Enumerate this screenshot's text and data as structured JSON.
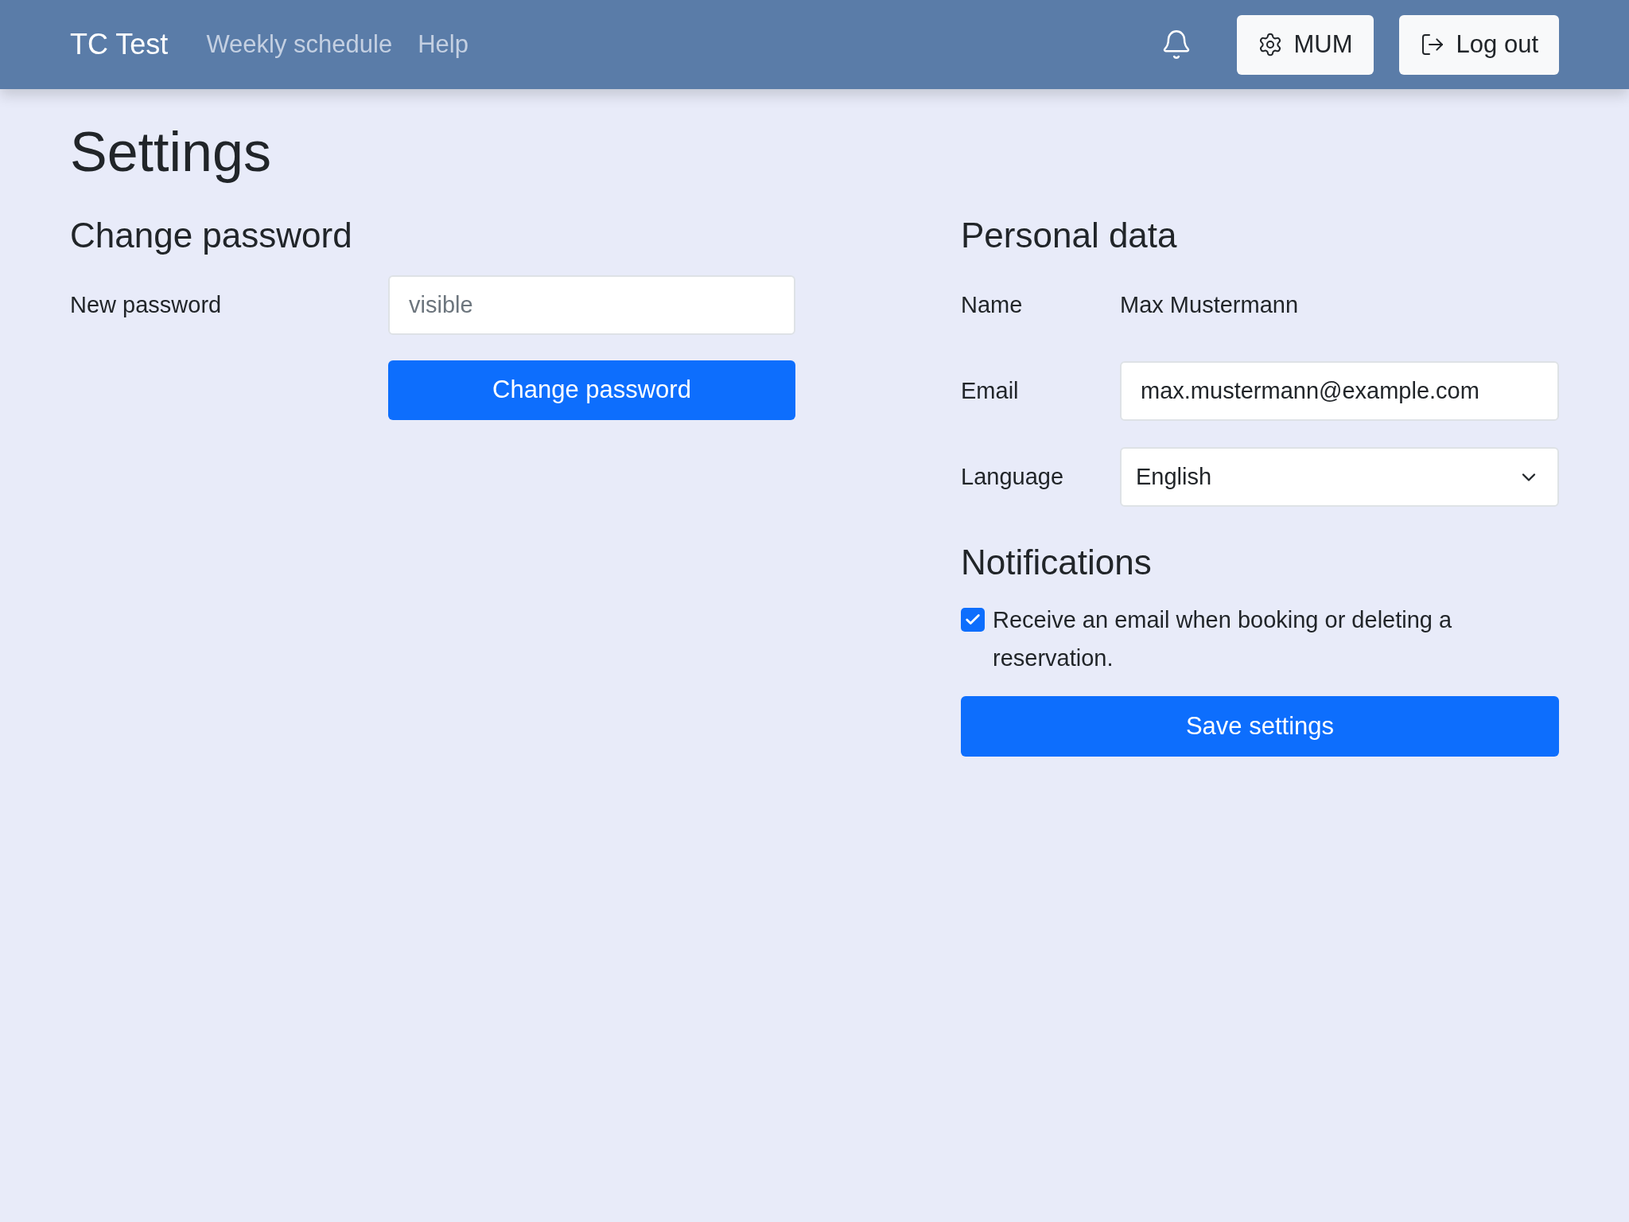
{
  "navbar": {
    "brand": "TC Test",
    "links": [
      {
        "label": "Weekly schedule"
      },
      {
        "label": "Help"
      }
    ],
    "user_button": "MUM",
    "logout_button": "Log out"
  },
  "page_title": "Settings",
  "change_password": {
    "heading": "Change password",
    "label": "New password",
    "placeholder": "visible",
    "button": "Change password"
  },
  "personal_data": {
    "heading": "Personal data",
    "name_label": "Name",
    "name_value": "Max Mustermann",
    "email_label": "Email",
    "email_value": "max.mustermann@example.com",
    "language_label": "Language",
    "language_value": "English"
  },
  "notifications": {
    "heading": "Notifications",
    "checkbox_label": "Receive an email when booking or deleting a reservation.",
    "checked": true
  },
  "save_button": "Save settings"
}
